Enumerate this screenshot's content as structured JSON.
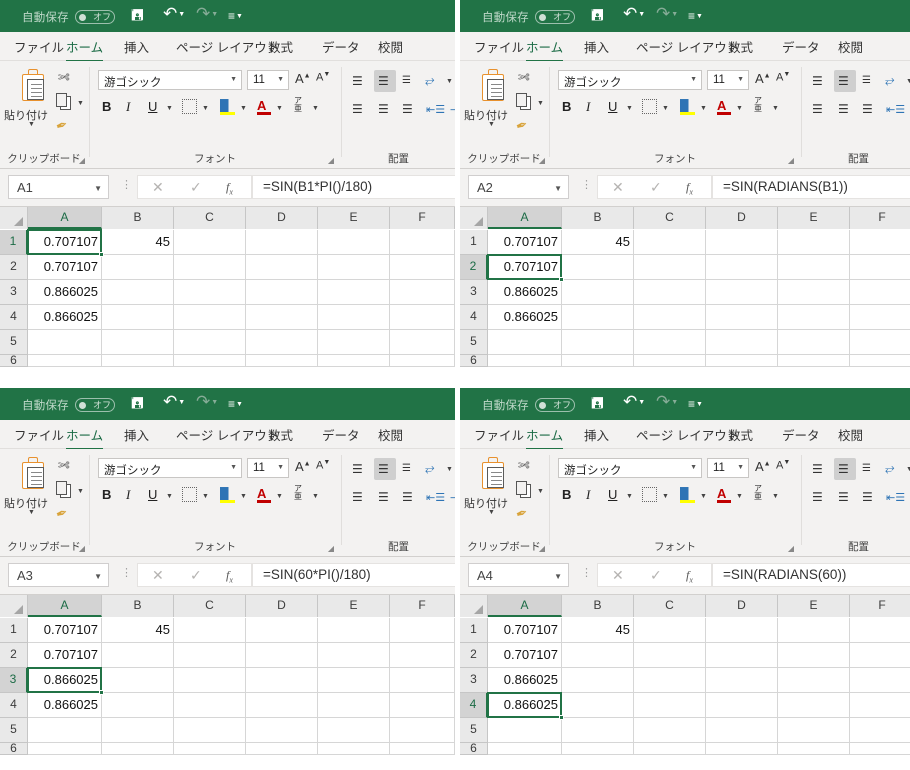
{
  "app": {
    "titlebar": {
      "autosave_label": "自動保存",
      "autosave_state": "オフ",
      "save_icon": "save-icon",
      "undo_icon": "undo-icon",
      "redo_icon": "redo-icon",
      "more_icon": "more-commands-icon"
    },
    "tabs": [
      {
        "label": "ファイル",
        "active": false
      },
      {
        "label": "ホーム",
        "active": true
      },
      {
        "label": "挿入",
        "active": false
      },
      {
        "label": "ページ レイアウト",
        "active": false
      },
      {
        "label": "数式",
        "active": false
      },
      {
        "label": "データ",
        "active": false
      },
      {
        "label": "校閲",
        "active": false
      }
    ],
    "ribbon": {
      "clipboard": {
        "group_label": "クリップボード",
        "paste_label": "貼り付け",
        "cut_icon": "scissors-icon",
        "copy_icon": "copy-icon",
        "format_painter_icon": "format-painter-icon"
      },
      "font": {
        "group_label": "フォント",
        "font_family_value": "游ゴシック",
        "font_size_value": "11",
        "grow_font_label": "A",
        "shrink_font_label": "A",
        "bold_label": "B",
        "italic_label": "I",
        "underline_label": "U",
        "border_icon": "borders-icon",
        "fill_color_icon": "fill-color-icon",
        "font_color_icon": "font-color-icon",
        "phonetic_label_top": "ア",
        "phonetic_label_bottom": "亜"
      },
      "alignment": {
        "group_label": "配置",
        "align_top_icon": "align-top-icon",
        "align_middle_icon": "align-middle-icon",
        "align_bottom_icon": "align-bottom-icon",
        "orientation_icon": "text-orientation-icon",
        "align_left_icon": "align-left-icon",
        "align_center_icon": "align-center-icon",
        "align_right_icon": "align-right-icon",
        "decrease_indent_icon": "decrease-indent-icon",
        "increase_indent_icon": "increase-indent-icon"
      }
    },
    "formula_bar": {
      "cancel_icon": "cancel-icon",
      "enter_icon": "enter-icon",
      "insert_function_icon": "insert-function-icon",
      "name_box_caret_icon": "chevron-down-icon",
      "expand_dots_icon": "expand-formula-bar-icon"
    },
    "grid": {
      "columns": [
        "A",
        "B",
        "C",
        "D",
        "E",
        "F"
      ],
      "rows": [
        "1",
        "2",
        "3",
        "4",
        "5",
        "6"
      ],
      "values": {
        "A1": "0.707107",
        "A2": "0.707107",
        "A3": "0.866025",
        "A4": "0.866025",
        "B1": "45"
      }
    },
    "colors": {
      "titlebar_green": "#217346",
      "ribbon_gray": "#f3f2f1",
      "selection_green": "#217346",
      "header_gray": "#e9e9e9",
      "gridline": "#d6d6d6"
    }
  },
  "panels": [
    {
      "id": "tl",
      "name_box": "A1",
      "formula": "=SIN(B1*PI()/180)",
      "selected_cell": "A1",
      "selected_row": "1"
    },
    {
      "id": "tr",
      "name_box": "A2",
      "formula": "=SIN(RADIANS(B1))",
      "selected_cell": "A2",
      "selected_row": "2"
    },
    {
      "id": "bl",
      "name_box": "A3",
      "formula": "=SIN(60*PI()/180)",
      "selected_cell": "A3",
      "selected_row": "3"
    },
    {
      "id": "br",
      "name_box": "A4",
      "formula": "=SIN(RADIANS(60))",
      "selected_cell": "A4",
      "selected_row": "4"
    }
  ]
}
